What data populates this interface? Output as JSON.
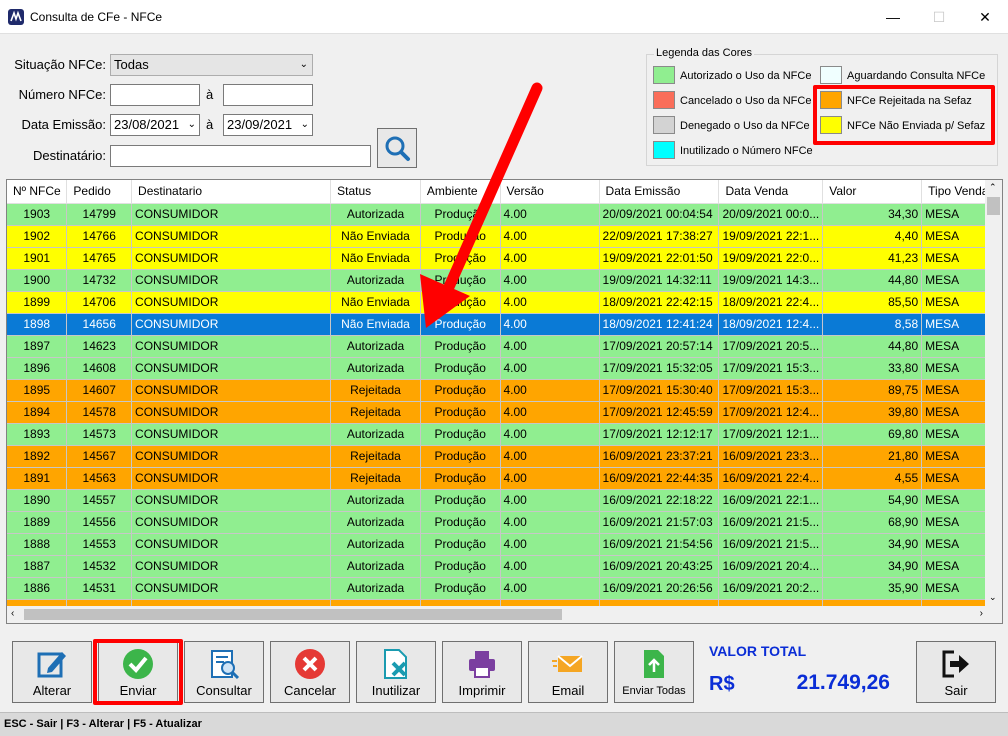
{
  "window": {
    "title": "Consulta de CFe - NFCe",
    "minimize_icon": "minimize-icon",
    "maximize_icon": "maximize-icon",
    "close_icon": "close-icon"
  },
  "filters": {
    "situacao_label": "Situação NFCe:",
    "situacao_value": "Todas",
    "numero_label": "Número NFCe:",
    "numero_from": "",
    "numero_to": "",
    "a_label": "à",
    "data_label": "Data Emissão:",
    "data_from": "23/08/2021",
    "data_to": "23/09/2021",
    "destinatario_label": "Destinatário:",
    "destinatario_value": ""
  },
  "legend": {
    "title": "Legenda das Cores",
    "items": [
      {
        "label": "Autorizado o Uso da NFCe",
        "color": "#90ee90"
      },
      {
        "label": "Cancelado o Uso da NFCe",
        "color": "#fa6e5a"
      },
      {
        "label": "Denegado o Uso da NFCe",
        "color": "#d3d3d3"
      },
      {
        "label": "Inutilizado o Número NFCe",
        "color": "#00ffff"
      },
      {
        "label": "Aguardando Consulta NFCe",
        "color": "#f0ffff"
      },
      {
        "label": "NFCe Rejeitada na Sefaz",
        "color": "#ffa500"
      },
      {
        "label": "NFCe Não Enviada p/ Sefaz",
        "color": "#ffff00"
      }
    ]
  },
  "table": {
    "columns": [
      "Nº NFCe",
      "Pedido",
      "Destinatario",
      "Status",
      "Ambiente",
      "Versão",
      "Data Emissão",
      "Data Venda",
      "Valor",
      "Tipo Venda"
    ],
    "rows": [
      {
        "kind": "g",
        "cells": [
          "1903",
          "14799",
          "CONSUMIDOR",
          "Autorizada",
          "Produção",
          "4.00",
          "20/09/2021 00:04:54",
          "20/09/2021 00:0...",
          "34,30",
          "MESA"
        ]
      },
      {
        "kind": "y",
        "cells": [
          "1902",
          "14766",
          "CONSUMIDOR",
          "Não Enviada",
          "Produção",
          "4.00",
          "22/09/2021 17:38:27",
          "19/09/2021 22:1...",
          "4,40",
          "MESA"
        ]
      },
      {
        "kind": "y",
        "cells": [
          "1901",
          "14765",
          "CONSUMIDOR",
          "Não Enviada",
          "Produção",
          "4.00",
          "19/09/2021 22:01:50",
          "19/09/2021 22:0...",
          "41,23",
          "MESA"
        ]
      },
      {
        "kind": "g",
        "cells": [
          "1900",
          "14732",
          "CONSUMIDOR",
          "Autorizada",
          "Produção",
          "4.00",
          "19/09/2021 14:32:11",
          "19/09/2021 14:3...",
          "44,80",
          "MESA"
        ]
      },
      {
        "kind": "y",
        "cells": [
          "1899",
          "14706",
          "CONSUMIDOR",
          "Não Enviada",
          "Produção",
          "4.00",
          "18/09/2021 22:42:15",
          "18/09/2021 22:4...",
          "85,50",
          "MESA"
        ]
      },
      {
        "kind": "sel",
        "cells": [
          "1898",
          "14656",
          "CONSUMIDOR",
          "Não Enviada",
          "Produção",
          "4.00",
          "18/09/2021 12:41:24",
          "18/09/2021 12:4...",
          "8,58",
          "MESA"
        ]
      },
      {
        "kind": "g",
        "cells": [
          "1897",
          "14623",
          "CONSUMIDOR",
          "Autorizada",
          "Produção",
          "4.00",
          "17/09/2021 20:57:14",
          "17/09/2021 20:5...",
          "44,80",
          "MESA"
        ]
      },
      {
        "kind": "g",
        "cells": [
          "1896",
          "14608",
          "CONSUMIDOR",
          "Autorizada",
          "Produção",
          "4.00",
          "17/09/2021 15:32:05",
          "17/09/2021 15:3...",
          "33,80",
          "MESA"
        ]
      },
      {
        "kind": "o",
        "cells": [
          "1895",
          "14607",
          "CONSUMIDOR",
          "Rejeitada",
          "Produção",
          "4.00",
          "17/09/2021 15:30:40",
          "17/09/2021 15:3...",
          "89,75",
          "MESA"
        ]
      },
      {
        "kind": "o",
        "cells": [
          "1894",
          "14578",
          "CONSUMIDOR",
          "Rejeitada",
          "Produção",
          "4.00",
          "17/09/2021 12:45:59",
          "17/09/2021 12:4...",
          "39,80",
          "MESA"
        ]
      },
      {
        "kind": "g",
        "cells": [
          "1893",
          "14573",
          "CONSUMIDOR",
          "Autorizada",
          "Produção",
          "4.00",
          "17/09/2021 12:12:17",
          "17/09/2021 12:1...",
          "69,80",
          "MESA"
        ]
      },
      {
        "kind": "o",
        "cells": [
          "1892",
          "14567",
          "CONSUMIDOR",
          "Rejeitada",
          "Produção",
          "4.00",
          "16/09/2021 23:37:21",
          "16/09/2021 23:3...",
          "21,80",
          "MESA"
        ]
      },
      {
        "kind": "o",
        "cells": [
          "1891",
          "14563",
          "CONSUMIDOR",
          "Rejeitada",
          "Produção",
          "4.00",
          "16/09/2021 22:44:35",
          "16/09/2021 22:4...",
          "4,55",
          "MESA"
        ]
      },
      {
        "kind": "g",
        "cells": [
          "1890",
          "14557",
          "CONSUMIDOR",
          "Autorizada",
          "Produção",
          "4.00",
          "16/09/2021 22:18:22",
          "16/09/2021 22:1...",
          "54,90",
          "MESA"
        ]
      },
      {
        "kind": "g",
        "cells": [
          "1889",
          "14556",
          "CONSUMIDOR",
          "Autorizada",
          "Produção",
          "4.00",
          "16/09/2021 21:57:03",
          "16/09/2021 21:5...",
          "68,90",
          "MESA"
        ]
      },
      {
        "kind": "g",
        "cells": [
          "1888",
          "14553",
          "CONSUMIDOR",
          "Autorizada",
          "Produção",
          "4.00",
          "16/09/2021 21:54:56",
          "16/09/2021 21:5...",
          "34,90",
          "MESA"
        ]
      },
      {
        "kind": "g",
        "cells": [
          "1887",
          "14532",
          "CONSUMIDOR",
          "Autorizada",
          "Produção",
          "4.00",
          "16/09/2021 20:43:25",
          "16/09/2021 20:4...",
          "34,90",
          "MESA"
        ]
      },
      {
        "kind": "g",
        "cells": [
          "1886",
          "14531",
          "CONSUMIDOR",
          "Autorizada",
          "Produção",
          "4.00",
          "16/09/2021 20:26:56",
          "16/09/2021 20:2...",
          "35,90",
          "MESA"
        ]
      },
      {
        "kind": "o",
        "cells": [
          "",
          "",
          "",
          "",
          "",
          "",
          "",
          "",
          "",
          ""
        ]
      }
    ]
  },
  "toolbar": {
    "alterar": "Alterar",
    "enviar": "Enviar",
    "consultar": "Consultar",
    "cancelar": "Cancelar",
    "inutilizar": "Inutilizar",
    "imprimir": "Imprimir",
    "email": "Email",
    "enviar_todas": "Enviar Todas",
    "sair": "Sair"
  },
  "total": {
    "label": "VALOR TOTAL",
    "currency": "R$",
    "value": "21.749,26"
  },
  "status_bar": "ESC - Sair | F3 - Alterar  |  F5 - Atualizar"
}
